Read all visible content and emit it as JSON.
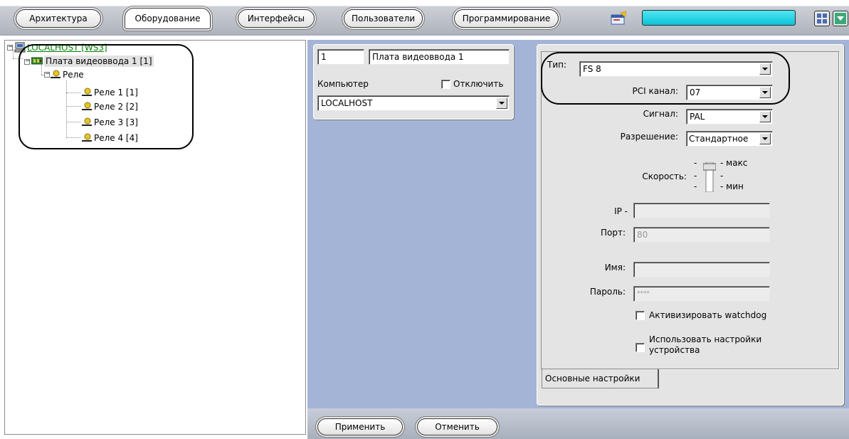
{
  "toolbar": {
    "tabs": [
      {
        "label": "Архитектура"
      },
      {
        "label": "Оборудование"
      },
      {
        "label": "Интерфейсы"
      },
      {
        "label": "Пользователи"
      },
      {
        "label": "Программирование"
      }
    ],
    "accent_color": "#17c9dc"
  },
  "tree": {
    "root": {
      "label": "LOCALHOST [WS3]",
      "icon": "computer-icon",
      "color": "#007f00"
    },
    "board": {
      "label": "Плата видеоввода 1 [1]",
      "icon": "video-board-icon"
    },
    "relay_group": {
      "label": "Реле",
      "icon": "relay-icon"
    },
    "relays": [
      {
        "label": "Реле 1 [1]"
      },
      {
        "label": "Реле 2 [2]"
      },
      {
        "label": "Реле 3 [3]"
      },
      {
        "label": "Реле 4 [4]"
      }
    ]
  },
  "object": {
    "id": "1",
    "name": "Плата видеоввода 1",
    "computer_label": "Компьютер",
    "disable_label": "Отключить",
    "computer_value": "LOCALHOST"
  },
  "settings": {
    "type_label": "Тип:",
    "type_value": "FS 8",
    "pci_label": "PCI канал:",
    "pci_value": "07",
    "signal_label": "Сигнал:",
    "signal_value": "PAL",
    "resolution_label": "Разрешение:",
    "resolution_value": "Стандартное",
    "speed_label": "Скорость:",
    "speed_max": "макс",
    "speed_min": "мин",
    "ip_label": "IP -",
    "ip_value": "",
    "port_label": "Порт:",
    "port_value": "80",
    "name_label": "Имя:",
    "name_value": "",
    "password_label": "Пароль:",
    "password_value": "****",
    "watchdog_label": "Активизировать watchdog",
    "device_settings_label_1": "Использовать настройки",
    "device_settings_label_2": "устройства",
    "tab_label": "Основные настройки"
  },
  "footer": {
    "apply_label": "Применить",
    "cancel_label": "Отменить"
  },
  "colors": {
    "content_background": "#a4b4d6",
    "panel_background": "#e4e4e4"
  }
}
